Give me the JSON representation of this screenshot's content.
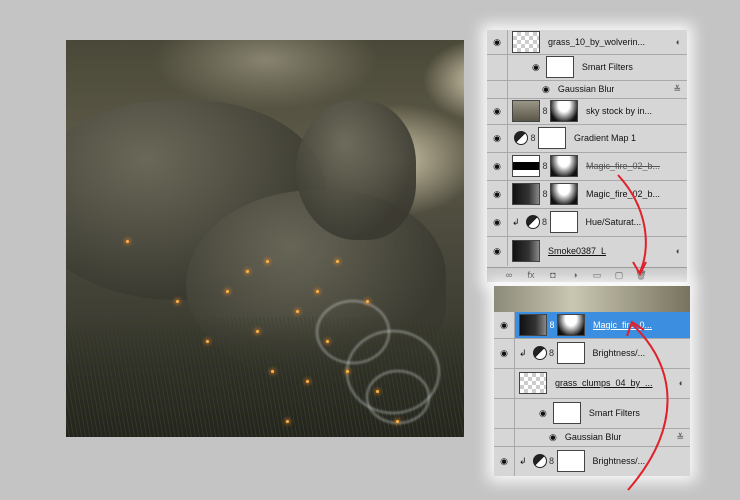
{
  "top_panel": {
    "layers": [
      {
        "name": "grass_10_by_wolverin...",
        "thumb": "checker",
        "type": "smart"
      },
      {
        "name": "Smart Filters",
        "type": "filter-group"
      },
      {
        "name": "Gaussian Blur",
        "type": "filter"
      },
      {
        "name": "sky stock by in...",
        "thumb": "sky",
        "type": "masked"
      },
      {
        "name": "Gradient Map 1",
        "type": "adjustment"
      },
      {
        "name": "Magic_fire_02_b...",
        "thumb": "fire",
        "type": "masked-struck"
      },
      {
        "name": "Magic_fire_02_b...",
        "thumb": "dark",
        "type": "masked"
      },
      {
        "name": "Hue/Saturat...",
        "type": "adjustment-clipped"
      },
      {
        "name": "Smoke0387_L",
        "thumb": "dark",
        "type": "smart"
      }
    ],
    "toolbar_icons": [
      "link-icon",
      "fx-icon",
      "mask-icon",
      "adjustment-icon",
      "folder-icon",
      "new-layer-icon",
      "trash-icon"
    ]
  },
  "bottom_panel": {
    "layers": [
      {
        "name": "Magic_fire_0...",
        "thumb": "dark",
        "type": "selected"
      },
      {
        "name": "Brightness/...",
        "type": "adjustment-clipped"
      },
      {
        "name": "grass_clumps_04_by_...",
        "thumb": "checker",
        "type": "smart"
      },
      {
        "name": "Smart Filters",
        "type": "filter-group"
      },
      {
        "name": "Gaussian Blur",
        "type": "filter"
      },
      {
        "name": "Brightness/...",
        "type": "adjustment-clipped"
      }
    ]
  },
  "colors": {
    "selection": "#3b8ee0",
    "arrow": "#e0202a"
  }
}
